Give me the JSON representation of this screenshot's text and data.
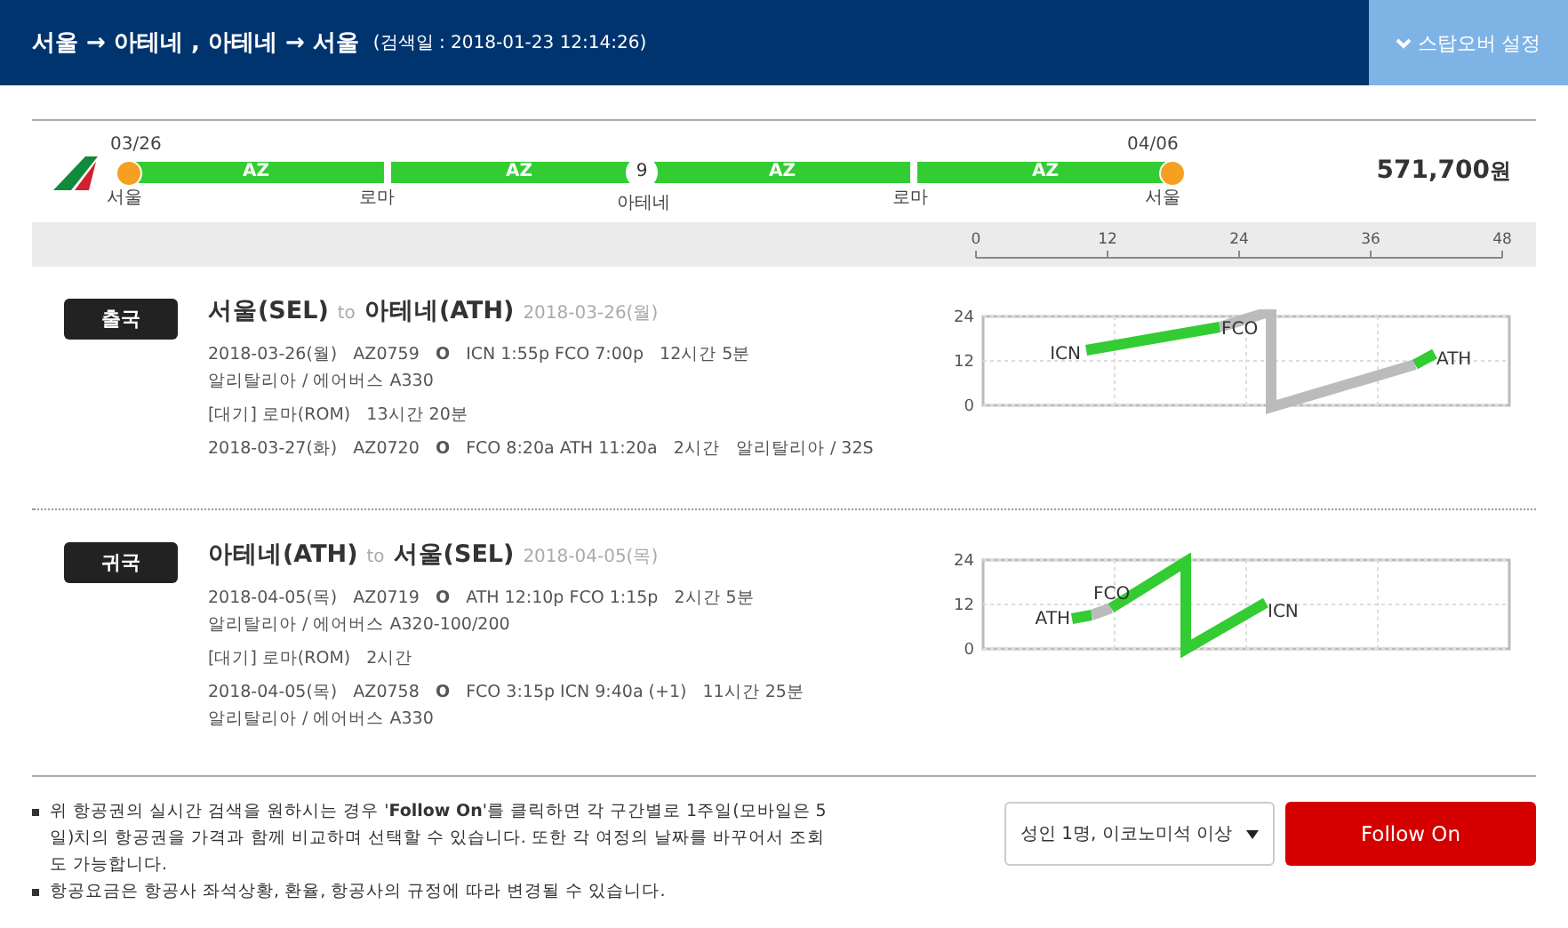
{
  "header": {
    "title": "서울 → 아테네 , 아테네 → 서울",
    "searched": "(검색일 : 2018-01-23 12:14:26)",
    "stopover_button": "스탑오버 설정"
  },
  "itinerary": {
    "start_date": "03/26",
    "end_date": "04/06",
    "stay_days": "9",
    "price": "571,700",
    "currency": "원",
    "segments": [
      {
        "carrier": "AZ"
      },
      {
        "carrier": "AZ"
      },
      {
        "carrier": "AZ"
      },
      {
        "carrier": "AZ"
      }
    ],
    "stops": [
      "서울",
      "로마",
      "아테네",
      "로마",
      "서울"
    ]
  },
  "time_axis": {
    "ticks": [
      "0",
      "12",
      "24",
      "36",
      "48"
    ]
  },
  "trips": [
    {
      "badge": "출국",
      "from": "서울(SEL)",
      "to_word": "to",
      "to": "아테네(ATH)",
      "date": "2018-03-26(월)",
      "lines": [
        {
          "kind": "flight",
          "text": "2018-03-26(월)   AZ0759   **O**   ICN 1:55p FCO 7:00p   12시간 5분"
        },
        {
          "kind": "aircraft",
          "text": "알리탈리아 / 에어버스 A330"
        },
        {
          "kind": "wait",
          "text": "[대기] 로마(ROM)   13시간 20분"
        },
        {
          "kind": "flight",
          "text": "2018-03-27(화)   AZ0720   **O**   FCO 8:20a ATH 11:20a   2시간   알리탈리아 / 32S"
        }
      ],
      "route_chart": {
        "yticks": [
          "24",
          "12",
          "0"
        ],
        "airports": [
          "ICN",
          "FCO",
          "ATH"
        ]
      }
    },
    {
      "badge": "귀국",
      "from": "아테네(ATH)",
      "to_word": "to",
      "to": "서울(SEL)",
      "date": "2018-04-05(목)",
      "lines": [
        {
          "kind": "flight",
          "text": "2018-04-05(목)   AZ0719   **O**   ATH 12:10p FCO 1:15p   2시간 5분"
        },
        {
          "kind": "aircraft",
          "text": "알리탈리아 / 에어버스 A320-100/200"
        },
        {
          "kind": "wait",
          "text": "[대기] 로마(ROM)   2시간"
        },
        {
          "kind": "flight",
          "text": "2018-04-05(목)   AZ0758   **O**   FCO 3:15p ICN 9:40a (+1)   11시간 25분"
        },
        {
          "kind": "aircraft",
          "text": "알리탈리아 / 에어버스 A330"
        }
      ],
      "route_chart": {
        "yticks": [
          "24",
          "12",
          "0"
        ],
        "airports": [
          "ATH",
          "FCO",
          "ICN"
        ]
      }
    }
  ],
  "notes": [
    "위 항공권의 실시간 검색을 원하시는 경우 '**Follow On**'를 클릭하면 각 구간별로 1주일(모바일은 5일)치의 항공권을 가격과 함께 비교하며 선택할 수 있습니다. 또한 각 여정의 날짜를 바꾸어서 조회도 가능합니다.",
    "항공요금은 항공사 좌석상황, 환율, 항공사의 규정에 따라 변경될 수 있습니다."
  ],
  "passenger_select": "성인 1명, 이코노미석 이상",
  "follow_button": "Follow On"
}
